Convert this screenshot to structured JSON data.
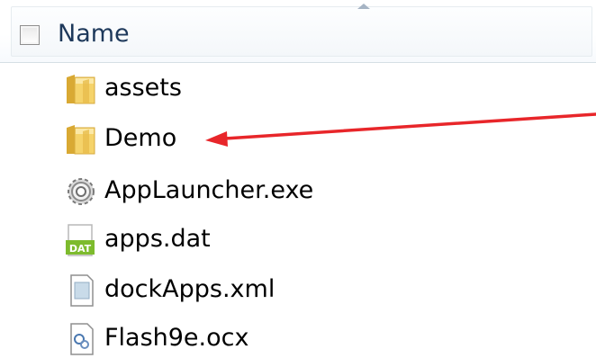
{
  "header": {
    "column_name": "Name",
    "sort": "ascending"
  },
  "files": [
    {
      "name": "assets",
      "icon": "folder-icon"
    },
    {
      "name": "Demo",
      "icon": "folder-icon"
    },
    {
      "name": "AppLauncher.exe",
      "icon": "executable-gear-icon"
    },
    {
      "name": "apps.dat",
      "icon": "dat-file-icon",
      "icon_text": "DAT"
    },
    {
      "name": "dockApps.xml",
      "icon": "document-icon"
    },
    {
      "name": "Flash9e.ocx",
      "icon": "activex-component-icon"
    }
  ],
  "annotation": {
    "type": "arrow",
    "target": "Demo",
    "color": "#e8262a"
  }
}
